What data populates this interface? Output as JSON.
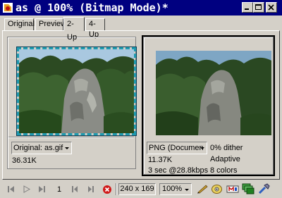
{
  "window": {
    "title": "as @ 100% (Bitmap Mode)*",
    "buttons": [
      "minimize-icon",
      "maximize-icon",
      "close-icon"
    ]
  },
  "tabs": [
    {
      "label": "Original",
      "active": false
    },
    {
      "label": "Preview",
      "active": false
    },
    {
      "label": "2-Up",
      "active": true
    },
    {
      "label": "4-Up",
      "active": false
    }
  ],
  "left_pane": {
    "format": "Original: as.gif",
    "size": "36.31K"
  },
  "right_pane": {
    "format": "PNG (Documen",
    "size": "11.37K",
    "time": "3 sec @28.8kbps",
    "dither": "0% dither",
    "palette": "Adaptive",
    "colors": "8 colors"
  },
  "statusbar": {
    "frame": "1",
    "dimensions": "240 x 169",
    "zoom": "100%",
    "icons": [
      "first-frame-icon",
      "play-icon",
      "last-frame-icon",
      "prev-frame-icon",
      "next-frame-icon",
      "stop-icon",
      "pencil-icon",
      "preview-in-browser-icon",
      "link-icon",
      "layers-icon",
      "tool-icon"
    ]
  }
}
